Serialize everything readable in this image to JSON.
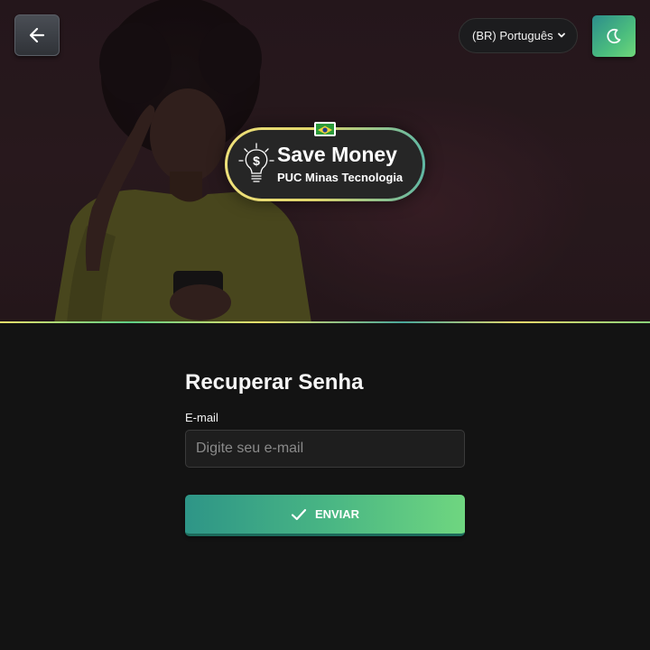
{
  "header": {
    "back_icon": "arrow-left-icon",
    "language": {
      "selected": "(BR) Português",
      "icon": "chevron-down-icon"
    },
    "theme_icon": "moon-icon"
  },
  "logo": {
    "title": "Save Money",
    "subtitle": "PUC Minas Tecnologia",
    "icon": "lightbulb-dollar-icon",
    "flag": "brazil-flag-icon"
  },
  "form": {
    "title": "Recuperar Senha",
    "email_label": "E-mail",
    "email_placeholder": "Digite seu e-mail",
    "email_value": "",
    "submit_label": "ENVIAR",
    "submit_icon": "check-icon"
  },
  "colors": {
    "background": "#131313",
    "accent_start": "#2e9587",
    "accent_end": "#6fd680",
    "badge_border": "#efe17a"
  }
}
